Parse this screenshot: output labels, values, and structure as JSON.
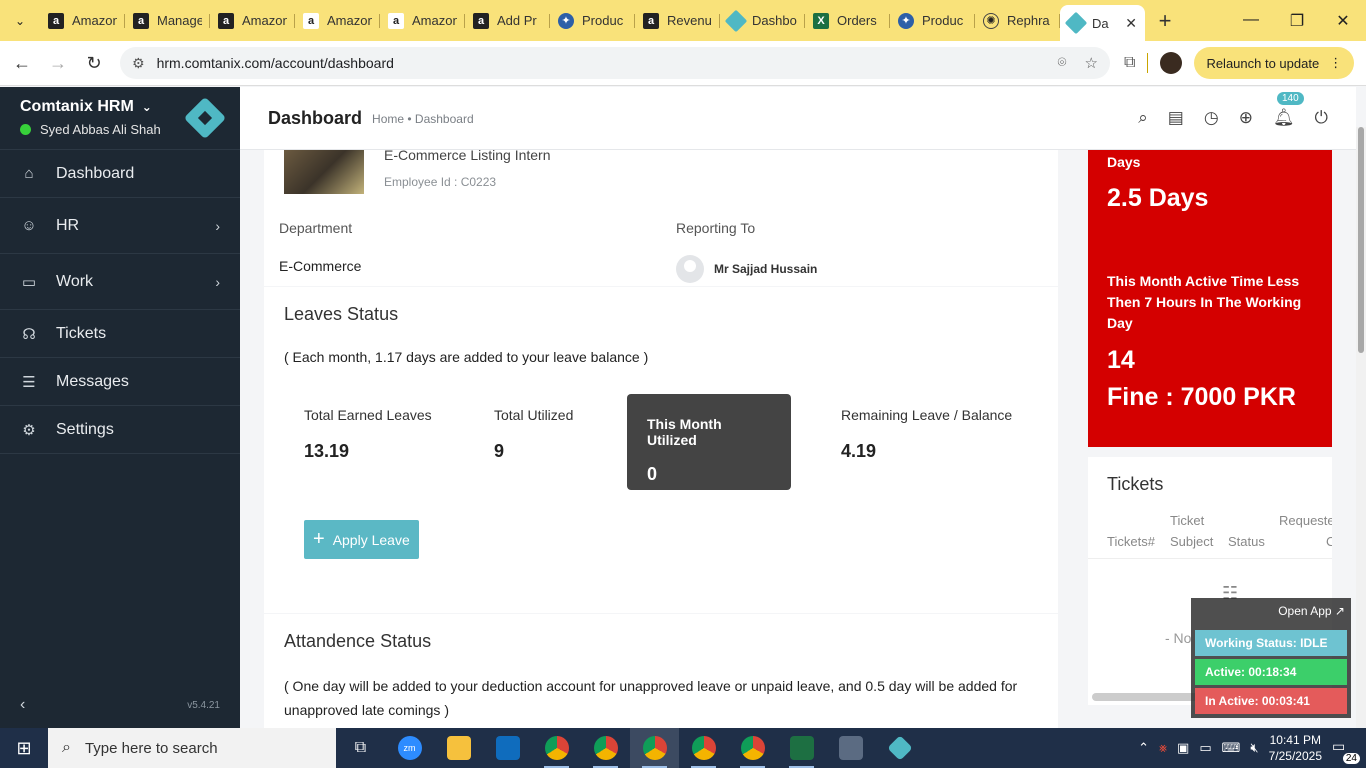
{
  "browser": {
    "tabs": [
      {
        "title": "Amazon",
        "icon": "amazon-icon"
      },
      {
        "title": "Manage",
        "icon": "amazon-icon"
      },
      {
        "title": "Amazon",
        "icon": "amazon-icon"
      },
      {
        "title": "Amazon",
        "icon": "amazon-icon"
      },
      {
        "title": "Amazon",
        "icon": "amazon-icon"
      },
      {
        "title": "Add Pr",
        "icon": "amazon-icon"
      },
      {
        "title": "Produc",
        "icon": "product-icon"
      },
      {
        "title": "Revenu",
        "icon": "amazon-icon"
      },
      {
        "title": "Dashbo",
        "icon": "dashboard-icon"
      },
      {
        "title": "Orders",
        "icon": "excel-icon"
      },
      {
        "title": "Produc",
        "icon": "product-icon"
      },
      {
        "title": "Rephra",
        "icon": "openai-icon"
      },
      {
        "title": "Da",
        "icon": "dashboard-icon"
      }
    ],
    "url": "hrm.comtanix.com/account/dashboard",
    "relaunch_label": "Relaunch to update"
  },
  "app": {
    "company": "Comtanix HRM",
    "user": "Syed Abbas Ali Shah",
    "version": "v5.4.21",
    "nav": [
      {
        "label": "Dashboard",
        "icon": "home-icon"
      },
      {
        "label": "HR",
        "icon": "users-icon"
      },
      {
        "label": "Work",
        "icon": "briefcase-icon"
      },
      {
        "label": "Tickets",
        "icon": "headset-icon"
      },
      {
        "label": "Messages",
        "icon": "message-icon"
      },
      {
        "label": "Settings",
        "icon": "gear-icon"
      }
    ],
    "page_title": "Dashboard",
    "breadcrumb": "Home • Dashboard",
    "notifications": "140"
  },
  "profile": {
    "role": "E-Commerce Listing Intern",
    "employee_id": "Employee Id : C0223",
    "department_label": "Department",
    "department": "E-Commerce",
    "reporting_label": "Reporting To",
    "reporting_to": "Mr Sajjad Hussain"
  },
  "leaves": {
    "title": "Leaves Status",
    "note": "( Each month, 1.17 days are added to your leave balance )",
    "stats": [
      {
        "label": "Total Earned Leaves",
        "value": "13.19"
      },
      {
        "label": "Total Utilized",
        "value": "9"
      },
      {
        "label": "This Month Utilized",
        "value": "0"
      },
      {
        "label": "Remaining Leave / Balance",
        "value": "4.19"
      }
    ],
    "apply_label": "Apply Leave"
  },
  "attendance": {
    "title": "Attandence Status",
    "note": "( One day will be added to your deduction account for unapproved leave or unpaid leave, and 0.5 day will be added for unapproved late comings )"
  },
  "fines": {
    "days_label": "Days",
    "days_value": "2.5 Days",
    "description": "This Month Active Time Less Then 7 Hours In The Working Day",
    "count": "14",
    "fine": "Fine : 7000 PKR"
  },
  "tickets": {
    "title": "Tickets",
    "col_number": "Tickets#",
    "col_subject_1": "Ticket",
    "col_subject_2": "Subject",
    "col_status": "Status",
    "col_requested_1": "Requeste",
    "col_requested_2": "C",
    "empty": "- No"
  },
  "widget": {
    "open_label": "Open App ↗",
    "working": "Working Status: IDLE",
    "active": "Active: 00:18:34",
    "inactive": "In Active: 00:03:41"
  },
  "taskbar": {
    "search_placeholder": "Type here to search",
    "time": "10:41 PM",
    "date": "7/25/2025",
    "notification_count": "24"
  }
}
